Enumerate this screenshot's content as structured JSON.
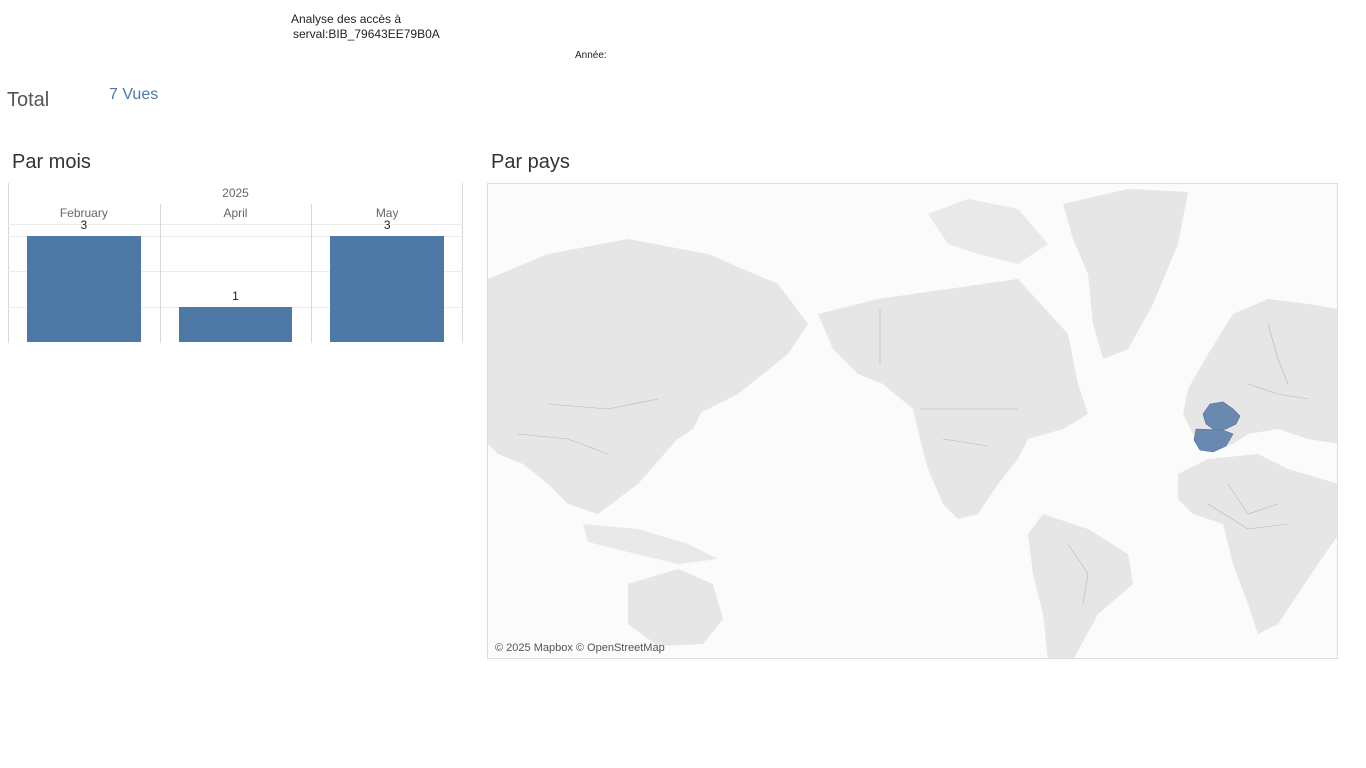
{
  "header": {
    "title_line1": "Analyse des accès à",
    "title_line2": "serval:BIB_79643EE79B0A",
    "year_filter_label": "Année:"
  },
  "summary": {
    "total_label": "Total",
    "total_value": "7 Vues"
  },
  "sections": {
    "by_month": "Par mois",
    "by_country": "Par pays"
  },
  "chart_data": {
    "type": "bar",
    "column_header": "2025",
    "categories": [
      "February",
      "April",
      "May"
    ],
    "values": [
      3,
      1,
      3
    ],
    "ylim": [
      0,
      3.3
    ],
    "color": "#4e79a7"
  },
  "map": {
    "attribution": "© 2025 Mapbox © OpenStreetMap",
    "highlighted_countries": [
      "France",
      "Spain"
    ],
    "highlight_color": "#6a89b0",
    "land_color": "#e6e6e6"
  }
}
